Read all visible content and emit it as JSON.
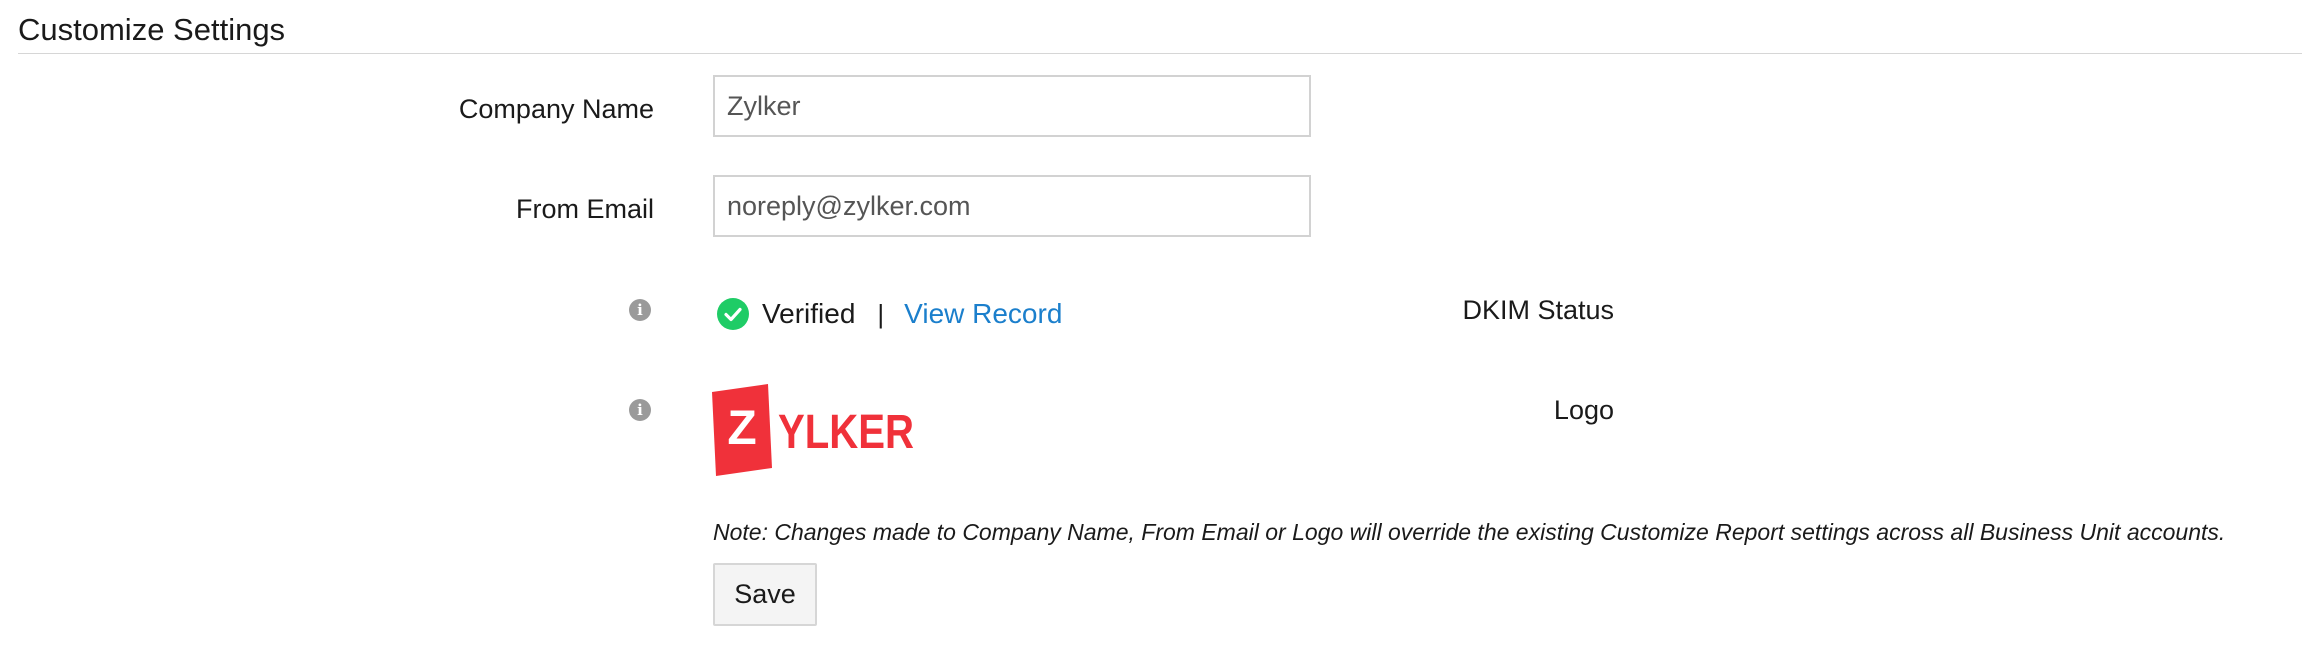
{
  "page": {
    "title": "Customize Settings"
  },
  "form": {
    "company_name": {
      "label": "Company Name",
      "value": "Zylker"
    },
    "from_email": {
      "label": "From Email",
      "value": "noreply@zylker.com"
    },
    "dkim_status": {
      "label": "DKIM Status",
      "info_icon": "info-icon",
      "status_icon": "check-circle-icon",
      "status_text": "Verified",
      "separator": "|",
      "link_label": "View Record"
    },
    "logo": {
      "label": "Logo",
      "info_icon": "info-icon",
      "logo_text": "ZYLKER"
    },
    "note": "Note: Changes made to Company Name, From Email or Logo will override the existing Customize Report settings across all Business Unit accounts.",
    "save_label": "Save"
  },
  "colors": {
    "link": "#1b7fcc",
    "success": "#1fcc66",
    "logo_red": "#f0313a",
    "info_icon": "#9a9a9a",
    "input_border": "#d2d2d2"
  }
}
